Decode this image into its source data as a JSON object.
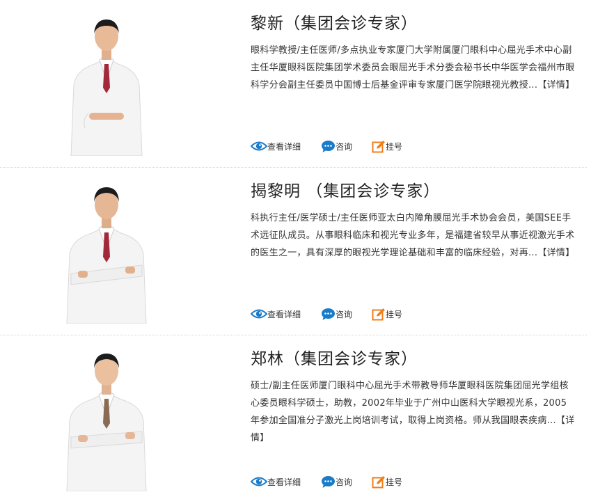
{
  "doctors": [
    {
      "name": "黎新（集团会诊专家）",
      "bio": "眼科学教授/主任医师/多点执业专家厦门大学附属厦门眼科中心屈光手术中心副主任华厦眼科医院集团学术委员会眼屈光手术分委会秘书长中华医学会福州市眼科学分会副主任委员中国博士后基金评审专家厦门医学院眼视光教授...",
      "detail": "【详情】",
      "actions": {
        "view": "查看详细",
        "consult": "咨询",
        "register": "挂号"
      }
    },
    {
      "name": "揭黎明 （集团会诊专家）",
      "bio": "科执行主任/医学硕士/主任医师亚太白内障角膜屈光手术协会会员，美国SEE手术远征队成员。从事眼科临床和视光专业多年，是福建省较早从事近视激光手术的医生之一，具有深厚的眼视光学理论基础和丰富的临床经验，对再...",
      "detail": "【详情】",
      "actions": {
        "view": "查看详细",
        "consult": "咨询",
        "register": "挂号"
      }
    },
    {
      "name": "郑林（集团会诊专家）",
      "bio": "硕士/副主任医师厦门眼科中心屈光手术带教导师华厦眼科医院集团屈光学组核心委员眼科学硕士，助教，2002年毕业于广州中山医科大学眼视光系，2005年参加全国准分子激光上岗培训考试，取得上岗资格。师从我国眼表疾病...",
      "detail": "【详情】",
      "actions": {
        "view": "查看详细",
        "consult": "咨询",
        "register": "挂号"
      }
    }
  ],
  "icons": {
    "view": "eye-icon",
    "consult": "chat-bubble-icon",
    "register": "edit-icon"
  },
  "colors": {
    "view_icon": "#1a7bc9",
    "consult_icon": "#1a7bc9",
    "register_icon": "#f07e1b",
    "separator": "#d6d6d6"
  }
}
